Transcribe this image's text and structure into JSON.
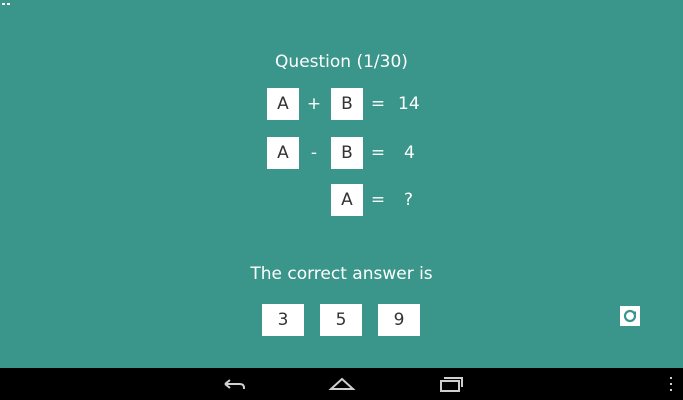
{
  "quiz": {
    "title": "Question (1/30)",
    "equations": [
      {
        "left": "A",
        "op": "+",
        "right": "B",
        "equals": "=",
        "result": "14"
      },
      {
        "left": "A",
        "op": "-",
        "right": "B",
        "equals": "=",
        "result": "4"
      },
      {
        "left": "",
        "op": "",
        "right": "A",
        "equals": "=",
        "result": "?"
      }
    ],
    "prompt": "The correct answer is",
    "choices": [
      "3",
      "5",
      "9"
    ]
  },
  "icons": {
    "refresh": "refresh-icon",
    "back": "back-icon",
    "home": "home-icon",
    "recents": "recents-icon",
    "menu": "overflow-menu-icon"
  },
  "colors": {
    "background": "#3a968b",
    "box": "#ffffff",
    "navbar": "#000000"
  }
}
